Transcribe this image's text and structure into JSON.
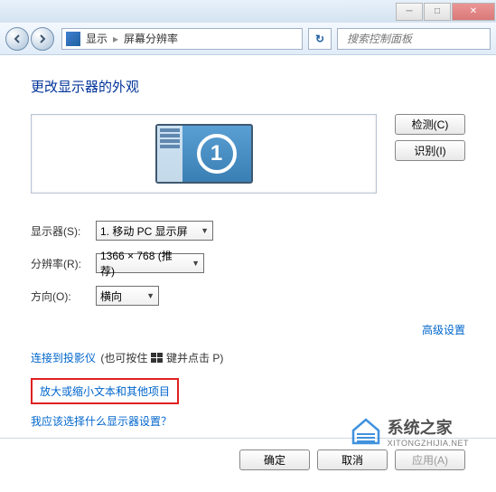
{
  "titlebar": {
    "minimize": "─",
    "maximize": "□",
    "close": "✕"
  },
  "nav": {
    "display_label": "显示",
    "resolution_label": "屏幕分辨率",
    "separator": "▸",
    "refresh": "↻",
    "search_placeholder": "搜索控制面板"
  },
  "heading": "更改显示器的外观",
  "preview": {
    "monitor_number": "1"
  },
  "buttons": {
    "detect": "检测(C)",
    "identify": "识别(I)",
    "ok": "确定",
    "cancel": "取消",
    "apply": "应用(A)"
  },
  "form": {
    "display_label": "显示器(S):",
    "display_value": "1. 移动 PC 显示屏",
    "resolution_label": "分辨率(R):",
    "resolution_value": "1366 × 768 (推荐)",
    "orientation_label": "方向(O):",
    "orientation_value": "横向"
  },
  "links": {
    "advanced": "高级设置",
    "projector_link": "连接到投影仪",
    "projector_hint_pre": " (也可按住 ",
    "projector_hint_post": " 键并点击 P)",
    "enlarge": "放大或缩小文本和其他项目",
    "which_monitor": "我应该选择什么显示器设置？"
  },
  "watermark": {
    "name": "系统之家",
    "url": "XITONGZHIJIA.NET"
  }
}
